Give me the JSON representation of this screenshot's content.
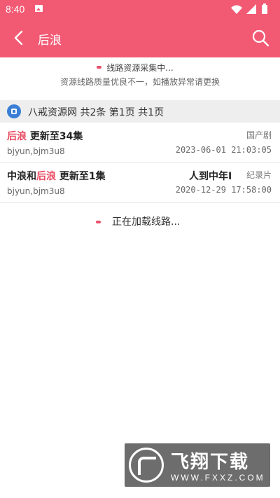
{
  "status_bar": {
    "time": "8:40"
  },
  "app_bar": {
    "title": "后浪"
  },
  "notice": {
    "line1": "线路资源采集中...",
    "line2": "资源线路质量优良不一，如播放异常请更换"
  },
  "source_header": {
    "text": "八戒资源网 共2条 第1页 共1页"
  },
  "results": [
    {
      "name_highlight": "后浪",
      "name_rest": " 更新至34集",
      "type": "国产剧",
      "source": "bjyun,bjm3u8",
      "date": "2023-06-01 21:03:05"
    },
    {
      "name_prefix": "中浪和",
      "name_highlight": "后浪",
      "name_rest": " 更新至1集",
      "actors": "人到中年I",
      "type": "纪录片",
      "source": "bjyun,bjm3u8",
      "date": "2020-12-29 17:58:00"
    }
  ],
  "loading": {
    "text": "正在加载线路..."
  },
  "watermark": {
    "brand": "飞翔下载",
    "site": "WWW.FXXZ.COM"
  },
  "colors": {
    "accent": "#f25a74",
    "highlight": "#e8485f"
  }
}
